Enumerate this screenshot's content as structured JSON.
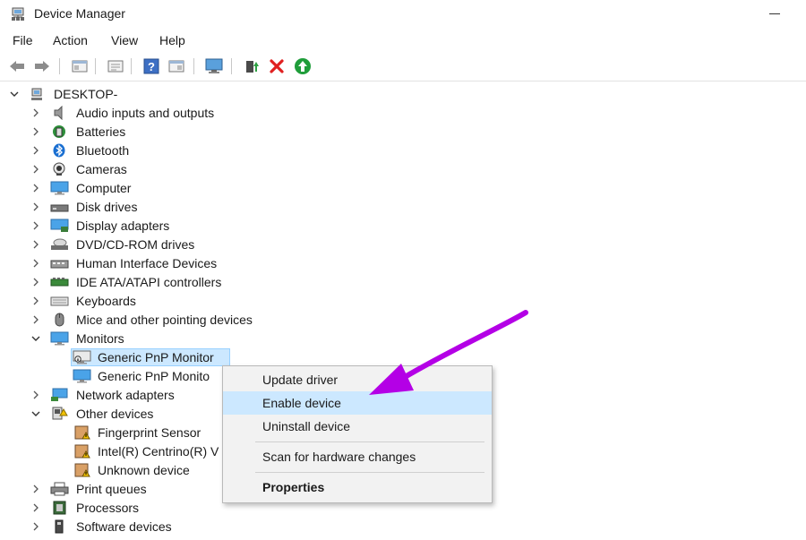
{
  "window": {
    "title": "Device Manager"
  },
  "menu": [
    "File",
    "Action",
    "View",
    "Help"
  ],
  "toolbar": {
    "buttons": [
      "back-icon",
      "forward-icon",
      "properties-view-icon",
      "show-hide-icon",
      "help-icon",
      "details-icon",
      "monitor-scan-icon",
      "update-driver-icon",
      "uninstall-icon",
      "enable-icon"
    ]
  },
  "tree": {
    "root": "DESKTOP-",
    "items": [
      {
        "label": "Audio inputs and outputs",
        "icon": "speaker-icon"
      },
      {
        "label": "Batteries",
        "icon": "battery-icon"
      },
      {
        "label": "Bluetooth",
        "icon": "bluetooth-icon"
      },
      {
        "label": "Cameras",
        "icon": "camera-icon"
      },
      {
        "label": "Computer",
        "icon": "computer-icon"
      },
      {
        "label": "Disk drives",
        "icon": "disk-drive-icon"
      },
      {
        "label": "Display adapters",
        "icon": "display-adapter-icon"
      },
      {
        "label": "DVD/CD-ROM drives",
        "icon": "dvd-drive-icon"
      },
      {
        "label": "Human Interface Devices",
        "icon": "hid-icon"
      },
      {
        "label": "IDE ATA/ATAPI controllers",
        "icon": "ide-controller-icon"
      },
      {
        "label": "Keyboards",
        "icon": "keyboard-icon"
      },
      {
        "label": "Mice and other pointing devices",
        "icon": "mouse-icon"
      },
      {
        "label": "Monitors",
        "icon": "monitor-icon",
        "expanded": true
      },
      {
        "label": "Generic PnP Monitor",
        "icon": "monitor-disabled-icon",
        "child": true,
        "selected": true
      },
      {
        "label": "Generic PnP Monito",
        "icon": "monitor-icon",
        "child": true
      },
      {
        "label": "Network adapters",
        "icon": "network-adapter-icon"
      },
      {
        "label": "Other devices",
        "icon": "other-devices-icon",
        "expanded": true
      },
      {
        "label": "Fingerprint Sensor",
        "icon": "unknown-device-icon",
        "child": true
      },
      {
        "label": "Intel(R) Centrino(R) V",
        "icon": "unknown-device-icon",
        "child": true
      },
      {
        "label": "Unknown device",
        "icon": "unknown-device-icon",
        "child": true
      },
      {
        "label": "Print queues",
        "icon": "printer-icon"
      },
      {
        "label": "Processors",
        "icon": "processor-icon"
      },
      {
        "label": "Software devices",
        "icon": "software-device-icon"
      }
    ]
  },
  "context_menu": {
    "items": [
      "Update driver",
      "Enable device",
      "Uninstall device",
      "Scan for hardware changes",
      "Properties"
    ],
    "highlighted": "Enable device"
  },
  "annotation": {
    "arrow_color": "#b400e6"
  },
  "colors": {
    "selection": "#cce8ff",
    "selection_border": "#99d1ff",
    "menu_bg": "#f2f2f2"
  }
}
